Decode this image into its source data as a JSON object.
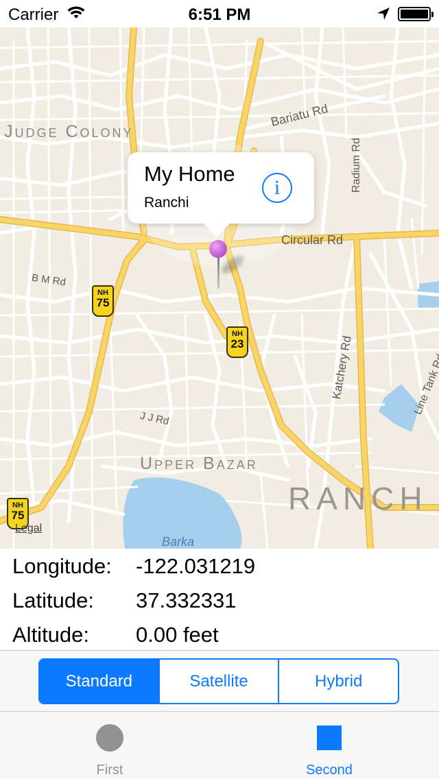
{
  "status_bar": {
    "carrier": "Carrier",
    "time": "6:51 PM",
    "icons": [
      "wifi-icon",
      "location-arrow-icon",
      "battery-icon"
    ]
  },
  "map": {
    "labels": {
      "judge_colony": "Judge Colony",
      "bariatu_rd": "Bariatu Rd",
      "radium_rd": "Radium Rd",
      "circular_rd": "Circular Rd",
      "bm_rd": "B M Rd",
      "katchery_rd": "Katchery Rd",
      "line_tank_rd": "Line Tank Rd",
      "jj_rd": "J J Rd",
      "upper_bazar": "Upper Bazar",
      "city": "RANCH",
      "barka": "Barka"
    },
    "shields": [
      {
        "top": "NH",
        "num": "75"
      },
      {
        "top": "NH",
        "num": "23"
      },
      {
        "top": "NH",
        "num": "75"
      }
    ],
    "legal": "Legal",
    "callout": {
      "title": "My Home",
      "subtitle": "Ranchi",
      "info_glyph": "i"
    },
    "colors": {
      "land": "#f1ede3",
      "road": "#ffffff",
      "highway": "#f8d567",
      "water": "#a6cfee",
      "pin": "#c25ad3"
    }
  },
  "info": {
    "longitude_label": "Longitude:",
    "longitude_value": "-122.031219",
    "latitude_label": "Latitude:",
    "latitude_value": "37.332331",
    "altitude_label": "Altitude:",
    "altitude_value": "0.00 feet"
  },
  "map_type": {
    "options": [
      "Standard",
      "Satellite",
      "Hybrid"
    ],
    "selected": "Standard"
  },
  "tab_bar": {
    "first_label": "First",
    "second_label": "Second",
    "selected": "Second",
    "accent": "#0a7aff",
    "inactive": "#929292"
  }
}
